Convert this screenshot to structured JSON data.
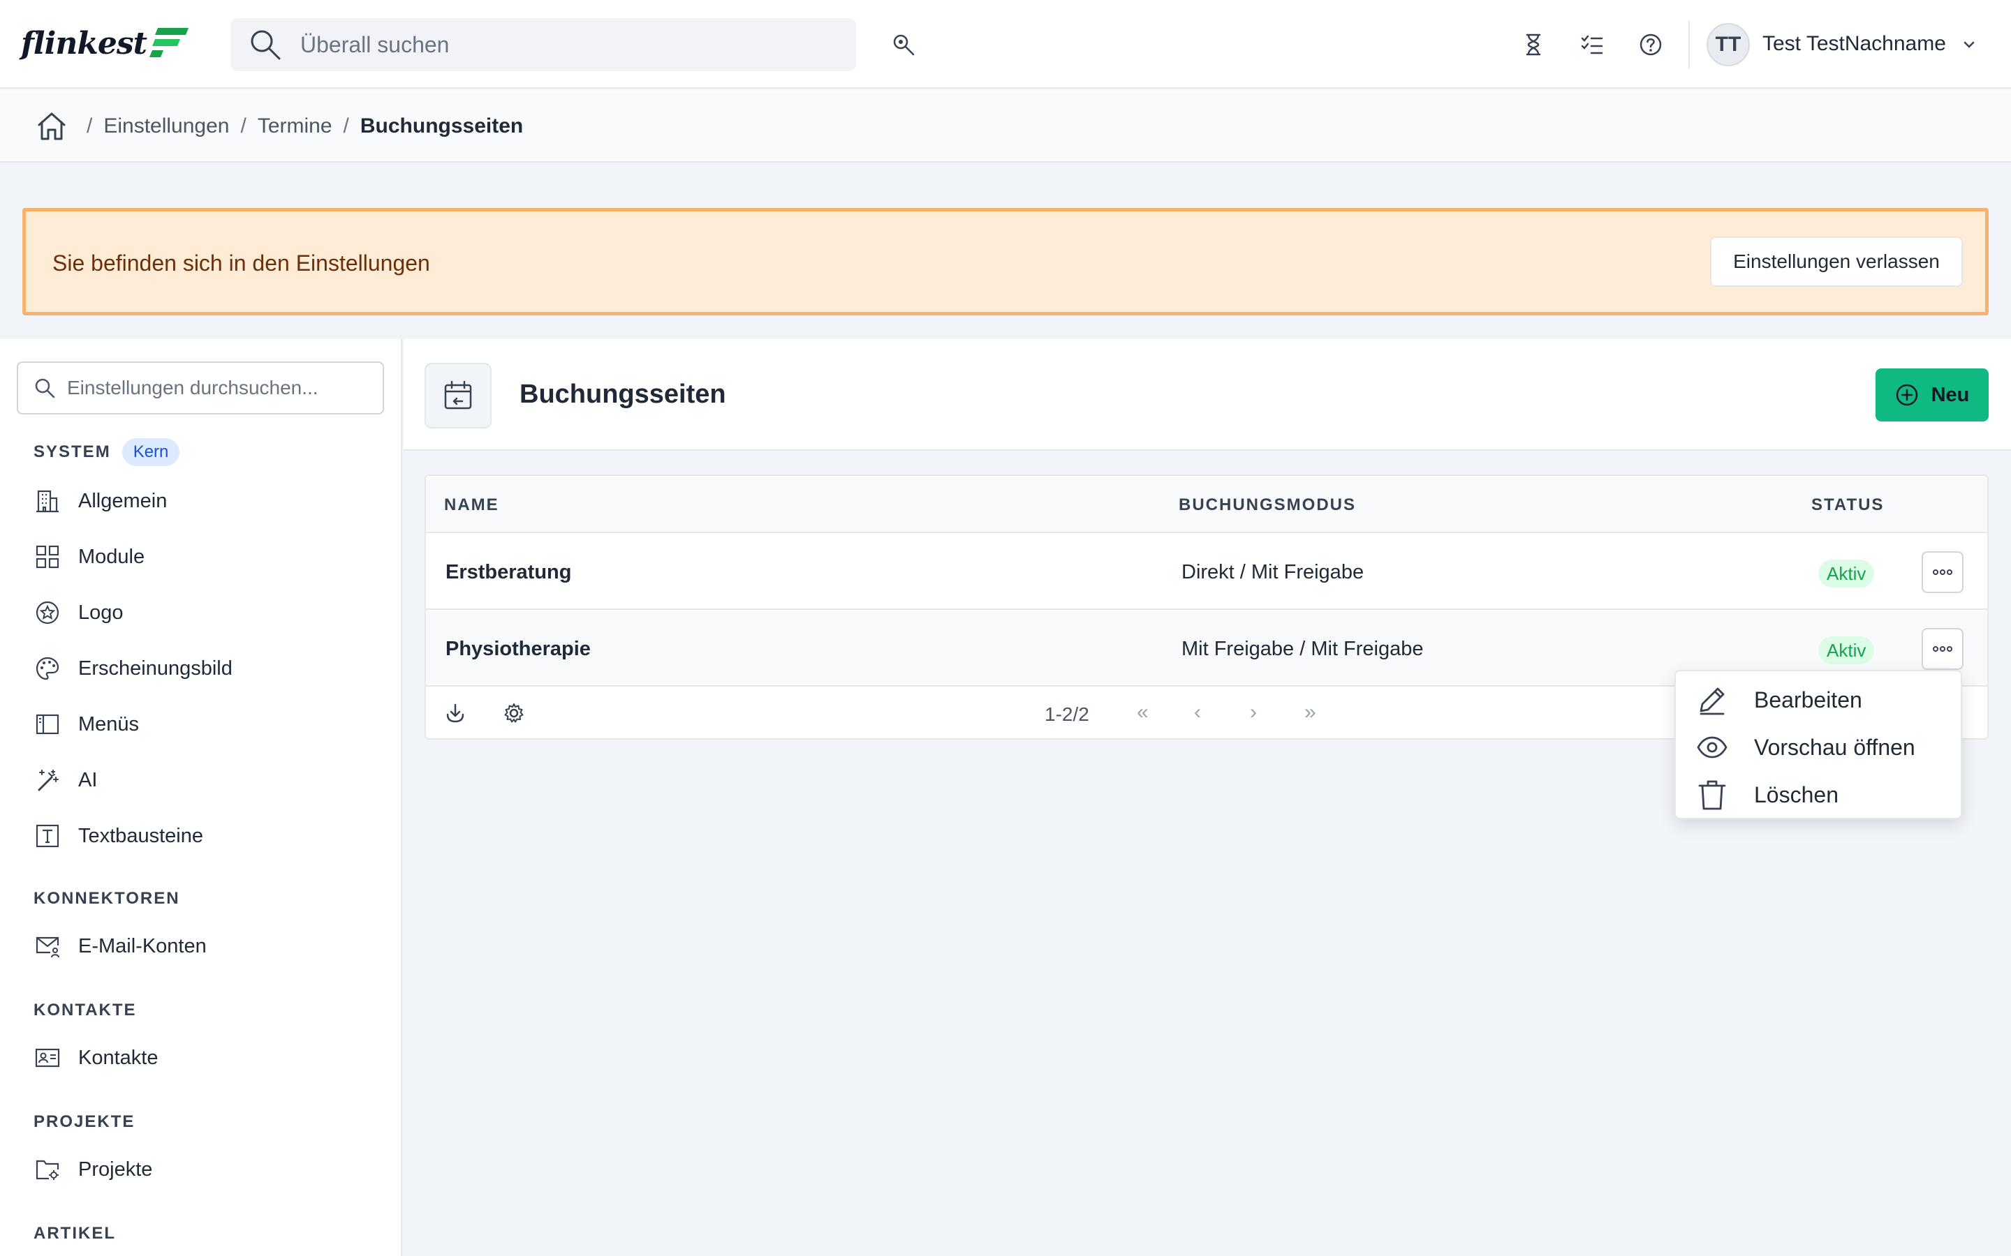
{
  "header": {
    "logo_text": "flinkest",
    "search_placeholder": "Überall suchen",
    "user_initials": "TT",
    "user_name": "Test TestNachname"
  },
  "breadcrumb": {
    "items": [
      "Einstellungen",
      "Termine"
    ],
    "current": "Buchungsseiten",
    "separator": "/"
  },
  "banner": {
    "text": "Sie befinden sich in den Einstellungen",
    "button_label": "Einstellungen verlassen"
  },
  "sidebar": {
    "search_placeholder": "Einstellungen durchsuchen...",
    "sections": [
      {
        "title": "SYSTEM",
        "badge": "Kern",
        "items": [
          "Allgemein",
          "Module",
          "Logo",
          "Erscheinungsbild",
          "Menüs",
          "AI",
          "Textbausteine"
        ]
      },
      {
        "title": "KONNEKTOREN",
        "items": [
          "E-Mail-Konten"
        ]
      },
      {
        "title": "KONTAKTE",
        "items": [
          "Kontakte"
        ]
      },
      {
        "title": "PROJEKTE",
        "items": [
          "Projekte"
        ]
      },
      {
        "title": "ARTIKEL",
        "items": []
      }
    ]
  },
  "main": {
    "title": "Buchungsseiten",
    "new_button": "Neu",
    "table": {
      "columns": [
        "NAME",
        "BUCHUNGSMODUS",
        "STATUS"
      ],
      "rows": [
        {
          "name": "Erstberatung",
          "mode": "Direkt / Mit Freigabe",
          "status": "Aktiv"
        },
        {
          "name": "Physiotherapie",
          "mode": "Mit Freigabe / Mit Freigabe",
          "status": "Aktiv"
        }
      ],
      "pagination": {
        "range": "1-2/2",
        "first": "«",
        "prev": "‹",
        "next": "›",
        "last": "»"
      }
    },
    "row_menu": {
      "items": [
        "Bearbeiten",
        "Vorschau öffnen",
        "Löschen"
      ]
    }
  },
  "colors": {
    "accent_green": "#10b981",
    "banner_bg": "#ffecd6",
    "banner_border": "#f7b36b",
    "status_green": "#16a34a"
  }
}
